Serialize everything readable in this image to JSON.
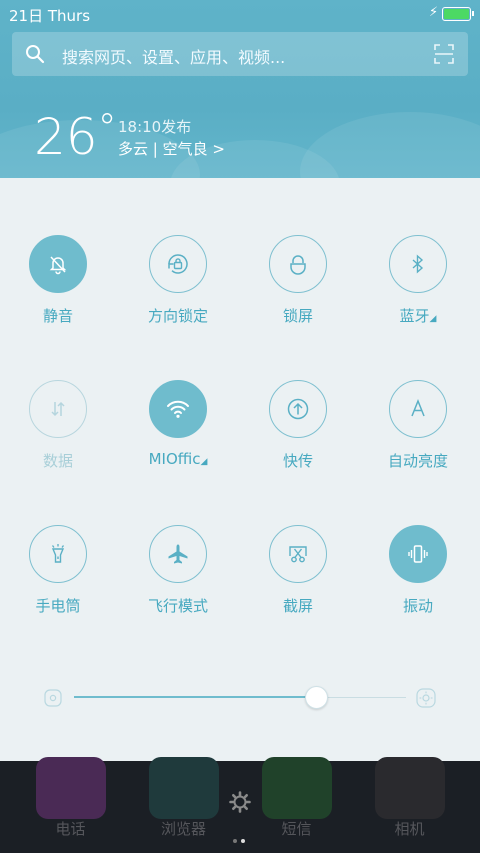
{
  "status": {
    "date": "21日",
    "day": "Thurs",
    "charging": "⚡"
  },
  "search": {
    "placeholder": "搜索网页、设置、应用、视频..."
  },
  "weather": {
    "temperature": "26",
    "degree": "°",
    "publish_time": "18:10发布",
    "condition": "多云 | 空气良 >"
  },
  "toggles": [
    {
      "label": "静音",
      "icon": "mute-bell-icon",
      "state": "on"
    },
    {
      "label": "方向锁定",
      "icon": "rotation-lock-icon",
      "state": "off"
    },
    {
      "label": "锁屏",
      "icon": "lock-icon",
      "state": "off"
    },
    {
      "label": "蓝牙",
      "icon": "bluetooth-icon",
      "state": "off",
      "expandable": true
    },
    {
      "label": "数据",
      "icon": "mobile-data-icon",
      "state": "disabled"
    },
    {
      "label": "MIOffic",
      "icon": "wifi-icon",
      "state": "on",
      "expandable": true
    },
    {
      "label": "快传",
      "icon": "quick-transfer-icon",
      "state": "off"
    },
    {
      "label": "自动亮度",
      "icon": "auto-brightness-icon",
      "state": "off"
    },
    {
      "label": "手电筒",
      "icon": "flashlight-icon",
      "state": "off"
    },
    {
      "label": "飞行模式",
      "icon": "airplane-icon",
      "state": "off"
    },
    {
      "label": "截屏",
      "icon": "screenshot-icon",
      "state": "off"
    },
    {
      "label": "振动",
      "icon": "vibrate-icon",
      "state": "on"
    }
  ],
  "brightness": {
    "level": 0.73
  },
  "dock": {
    "apps": [
      {
        "label": "电话",
        "icon": "phone-app-icon",
        "color": "#4a2a55"
      },
      {
        "label": "浏览器",
        "icon": "browser-app-icon",
        "color": "#1f3a3c"
      },
      {
        "label": "短信",
        "icon": "messages-app-icon",
        "color": "#20422a"
      },
      {
        "label": "相机",
        "icon": "camera-app-icon",
        "color": "#2a2a2e"
      }
    ]
  },
  "colors": {
    "accent": "#6fbccd",
    "header": "#5fb3c9",
    "panel": "#ebf1f3"
  }
}
